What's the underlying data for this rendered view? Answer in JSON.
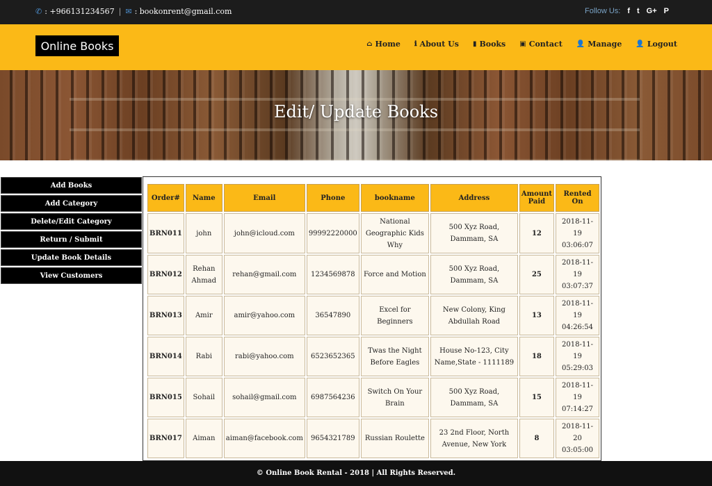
{
  "topbar": {
    "phone": ": +966131234567",
    "email": ": bookonrent@gmail.com",
    "follow_label": "Follow Us:",
    "social": [
      "f",
      "t",
      "G+",
      "P"
    ]
  },
  "header": {
    "logo": "Online Books",
    "nav": [
      {
        "icon": "⌂",
        "label": "Home"
      },
      {
        "icon": "ℹ",
        "label": "About Us"
      },
      {
        "icon": "▮",
        "label": "Books"
      },
      {
        "icon": "▣",
        "label": "Contact"
      },
      {
        "icon": "👤",
        "label": "Manage"
      },
      {
        "icon": "👤",
        "label": "Logout"
      }
    ]
  },
  "banner": {
    "title": "Edit/ Update Books"
  },
  "sidebar": {
    "items": [
      "Add Books",
      "Add Category",
      "Delete/Edit Category",
      "Return / Submit",
      "Update Book Details",
      "View Customers"
    ]
  },
  "table": {
    "headers": [
      "Order#",
      "Name",
      "Email",
      "Phone",
      "bookname",
      "Address",
      "Amount Paid",
      "Rented On"
    ],
    "rows": [
      [
        "BRN011",
        "john",
        "john@icloud.com",
        "99992220000",
        "National Geographic Kids Why",
        "500 Xyz Road, Dammam, SA",
        "12",
        "2018-11-19 03:06:07"
      ],
      [
        "BRN012",
        "Rehan Ahmad",
        "rehan@gmail.com",
        "1234569878",
        "Force and Motion",
        "500 Xyz Road, Dammam, SA",
        "25",
        "2018-11-19 03:07:37"
      ],
      [
        "BRN013",
        "Amir",
        "amir@yahoo.com",
        "36547890",
        "Excel for Beginners",
        "New Colony, King Abdullah Road",
        "13",
        "2018-11-19 04:26:54"
      ],
      [
        "BRN014",
        "Rabi",
        "rabi@yahoo.com",
        "6523652365",
        "Twas the Night Before Eagles",
        "House No-123, City Name,State - 1111189",
        "18",
        "2018-11-19 05:29:03"
      ],
      [
        "BRN015",
        "Sohail",
        "sohail@gmail.com",
        "6987564236",
        "Switch On Your Brain",
        "500 Xyz Road, Dammam, SA",
        "15",
        "2018-11-19 07:14:27"
      ],
      [
        "BRN017",
        "Aiman",
        "aiman@facebook.com",
        "9654321789",
        "Russian Roulette",
        "23 2nd Floor, North Avenue, New York",
        "8",
        "2018-11-20 03:05:00"
      ]
    ]
  },
  "footer": {
    "text": "© Online Book Rental - 2018 | All Rights Reserved."
  }
}
